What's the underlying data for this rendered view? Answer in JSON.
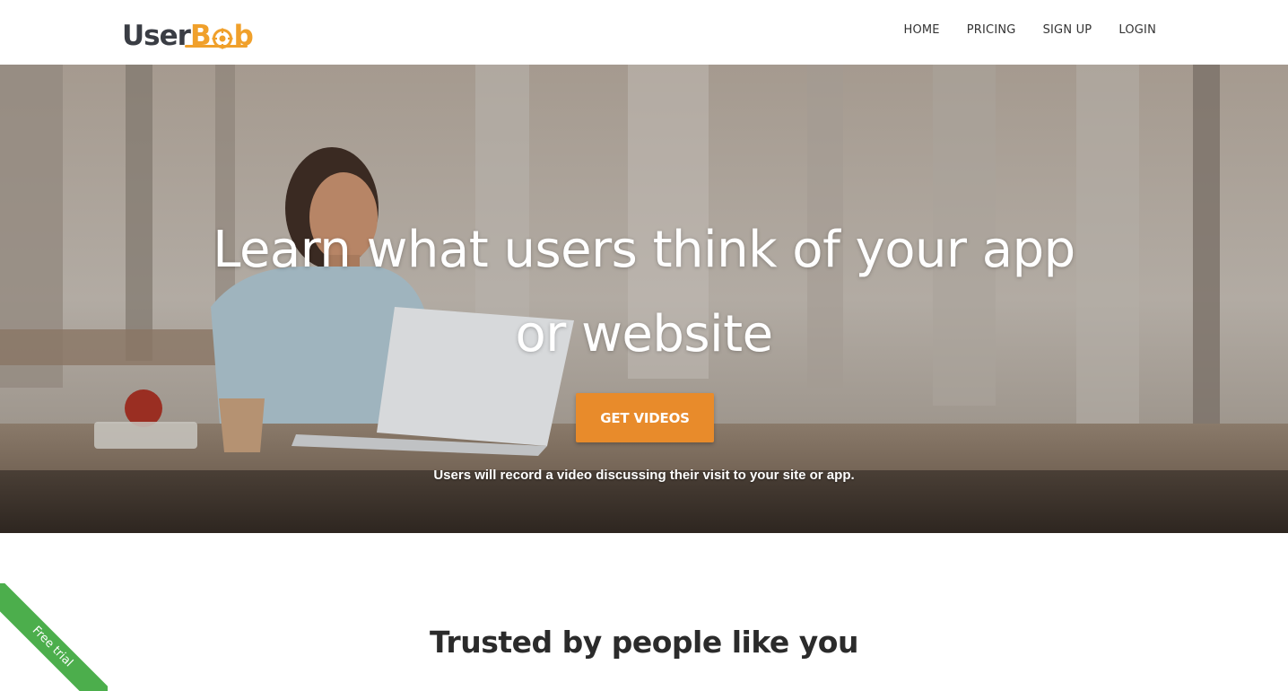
{
  "logo": {
    "part_a": "User",
    "part_b_prefix": "B",
    "part_b_suffix": "b",
    "icon": "target-icon",
    "colors": {
      "dark": "#3a3d44",
      "accent": "#f0a02b"
    }
  },
  "nav": {
    "items": [
      {
        "label": "HOME"
      },
      {
        "label": "PRICING"
      },
      {
        "label": "SIGN UP"
      },
      {
        "label": "LOGIN"
      }
    ]
  },
  "hero": {
    "title": "Learn what users think of your app or website",
    "cta_label": "GET VIDEOS",
    "subtitle": "Users will record a video discussing their visit to your site or app.",
    "cta_color": "#e88b2b"
  },
  "section": {
    "trusted_heading": "Trusted by people like you"
  },
  "ribbon": {
    "label": "Free trial",
    "color": "#4cae4c"
  }
}
